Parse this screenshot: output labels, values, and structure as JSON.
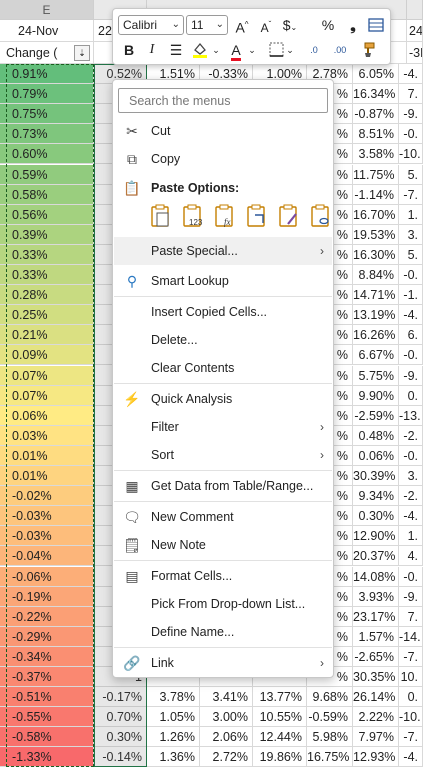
{
  "sheet": {
    "col_e_header": "E",
    "row2_e": "24-Nov",
    "row2_f": "22",
    "row2_last": "24-",
    "row3_e": "Change (",
    "row3_last": "-3M",
    "rows": [
      {
        "e": "0.91%",
        "f": "0.52%",
        "g": "1.51%",
        "h": "-0.33%",
        "i": "1.00%",
        "j": "2.78%",
        "k": "6.05%",
        "l": "-4."
      },
      {
        "e": "0.79%",
        "f": "1",
        "g": "",
        "h": "",
        "i": "",
        "j": "%",
        "k": "16.34%",
        "l": "7."
      },
      {
        "e": "0.75%",
        "f": "1",
        "g": "",
        "h": "",
        "i": "",
        "j": "%",
        "k": "-0.87%",
        "l": "-9."
      },
      {
        "e": "0.73%",
        "f": "0",
        "g": "",
        "h": "",
        "i": "",
        "j": "%",
        "k": "8.51%",
        "l": "-0."
      },
      {
        "e": "0.60%",
        "f": "0",
        "g": "",
        "h": "",
        "i": "",
        "j": "%",
        "k": "3.58%",
        "l": "-10."
      },
      {
        "e": "0.59%",
        "f": "0",
        "g": "",
        "h": "",
        "i": "",
        "j": "%",
        "k": "11.75%",
        "l": "5."
      },
      {
        "e": "0.58%",
        "f": "1",
        "g": "",
        "h": "",
        "i": "",
        "j": "%",
        "k": "-1.14%",
        "l": "-7."
      },
      {
        "e": "0.56%",
        "f": "0",
        "g": "",
        "h": "",
        "i": "",
        "j": "%",
        "k": "16.70%",
        "l": "1."
      },
      {
        "e": "0.39%",
        "f": "0",
        "g": "",
        "h": "",
        "i": "",
        "j": "%",
        "k": "19.53%",
        "l": "3."
      },
      {
        "e": "0.33%",
        "f": "0",
        "g": "",
        "h": "",
        "i": "",
        "j": "%",
        "k": "16.30%",
        "l": "5."
      },
      {
        "e": "0.33%",
        "f": "1",
        "g": "",
        "h": "",
        "i": "",
        "j": "%",
        "k": "8.84%",
        "l": "-0."
      },
      {
        "e": "0.28%",
        "f": "0",
        "g": "",
        "h": "",
        "i": "",
        "j": "%",
        "k": "14.71%",
        "l": "-1."
      },
      {
        "e": "0.25%",
        "f": "0",
        "g": "",
        "h": "",
        "i": "",
        "j": "%",
        "k": "13.19%",
        "l": "-4."
      },
      {
        "e": "0.21%",
        "f": "0",
        "g": "",
        "h": "",
        "i": "",
        "j": "%",
        "k": "16.26%",
        "l": "6."
      },
      {
        "e": "0.09%",
        "f": "0",
        "g": "",
        "h": "",
        "i": "",
        "j": "%",
        "k": "6.67%",
        "l": "-0."
      },
      {
        "e": "0.07%",
        "f": "0",
        "g": "",
        "h": "",
        "i": "",
        "j": "%",
        "k": "5.75%",
        "l": "-9."
      },
      {
        "e": "0.07%",
        "f": "0",
        "g": "",
        "h": "",
        "i": "",
        "j": "%",
        "k": "9.90%",
        "l": "0."
      },
      {
        "e": "0.06%",
        "f": "1",
        "g": "",
        "h": "",
        "i": "",
        "j": "%",
        "k": "-2.59%",
        "l": "-13."
      },
      {
        "e": "0.03%",
        "f": "0",
        "g": "",
        "h": "",
        "i": "",
        "j": "%",
        "k": "0.48%",
        "l": "-2."
      },
      {
        "e": "0.01%",
        "f": "0",
        "g": "",
        "h": "",
        "i": "",
        "j": "%",
        "k": "0.06%",
        "l": "-0."
      },
      {
        "e": "0.01%",
        "f": "-1",
        "g": "",
        "h": "",
        "i": "",
        "j": "%",
        "k": "30.39%",
        "l": "3."
      },
      {
        "e": "-0.02%",
        "f": "0",
        "g": "",
        "h": "",
        "i": "",
        "j": "%",
        "k": "9.34%",
        "l": "-2."
      },
      {
        "e": "-0.03%",
        "f": "1",
        "g": "",
        "h": "",
        "i": "",
        "j": "%",
        "k": "0.30%",
        "l": "-4."
      },
      {
        "e": "-0.03%",
        "f": "1",
        "g": "",
        "h": "",
        "i": "",
        "j": "%",
        "k": "12.90%",
        "l": "1."
      },
      {
        "e": "-0.04%",
        "f": "0",
        "g": "",
        "h": "",
        "i": "",
        "j": "%",
        "k": "20.37%",
        "l": "4."
      },
      {
        "e": "-0.06%",
        "f": "0",
        "g": "",
        "h": "",
        "i": "",
        "j": "%",
        "k": "14.08%",
        "l": "-0."
      },
      {
        "e": "-0.19%",
        "f": "1",
        "g": "",
        "h": "",
        "i": "",
        "j": "%",
        "k": "3.93%",
        "l": "-9."
      },
      {
        "e": "-0.22%",
        "f": "-0",
        "g": "",
        "h": "",
        "i": "",
        "j": "%",
        "k": "23.17%",
        "l": "7."
      },
      {
        "e": "-0.29%",
        "f": "2",
        "g": "",
        "h": "",
        "i": "",
        "j": "%",
        "k": "1.57%",
        "l": "-14."
      },
      {
        "e": "-0.34%",
        "f": "1",
        "g": "",
        "h": "",
        "i": "",
        "j": "%",
        "k": "-2.65%",
        "l": "-7."
      },
      {
        "e": "-0.37%",
        "f": "-1",
        "g": "",
        "h": "",
        "i": "",
        "j": "%",
        "k": "30.35%",
        "l": "10."
      },
      {
        "e": "-0.51%",
        "f": "-0.17%",
        "g": "3.78%",
        "h": "3.41%",
        "i": "13.77%",
        "j": "9.68%",
        "k": "26.14%",
        "l": "0."
      },
      {
        "e": "-0.55%",
        "f": "0.70%",
        "g": "1.05%",
        "h": "3.00%",
        "i": "10.55%",
        "j": "-0.59%",
        "k": "2.22%",
        "l": "-10."
      },
      {
        "e": "-0.58%",
        "f": "0.30%",
        "g": "1.26%",
        "h": "2.06%",
        "i": "12.44%",
        "j": "5.98%",
        "k": "7.97%",
        "l": "-7."
      },
      {
        "e": "-1.33%",
        "f": "-0.14%",
        "g": "1.36%",
        "h": "2.72%",
        "i": "19.86%",
        "j": "16.75%",
        "k": "12.93%",
        "l": "-4."
      }
    ]
  },
  "mini_toolbar": {
    "font_name": "Calibri",
    "font_size": "11",
    "grow_label": "A",
    "shrink_label": "A",
    "currency_label": "$",
    "percent_label": "%",
    "comma_label": "❟",
    "bold_label": "B",
    "italic_label": "I",
    "font_color_label": "A",
    "increase_decimal_label": ".0",
    "decrease_decimal_label": ".00"
  },
  "context_menu": {
    "search_placeholder": "Search the menus",
    "cut": "Cut",
    "copy": "Copy",
    "paste_options": "Paste Options:",
    "paste_special": "Paste Special...",
    "smart_lookup": "Smart Lookup",
    "insert_copied_cells": "Insert Copied Cells...",
    "delete": "Delete...",
    "clear_contents": "Clear Contents",
    "quick_analysis": "Quick Analysis",
    "filter": "Filter",
    "sort": "Sort",
    "get_data": "Get Data from Table/Range...",
    "new_comment": "New Comment",
    "new_note": "New Note",
    "format_cells": "Format Cells...",
    "pick_from_list": "Pick From Drop-down List...",
    "define_name": "Define Name...",
    "link": "Link"
  },
  "colors": {
    "accent_green": "#217346",
    "selection_border": "#1b5e20",
    "scale_high": "#63be7b",
    "scale_mid": "#ffeb84",
    "scale_low": "#f8696b"
  }
}
